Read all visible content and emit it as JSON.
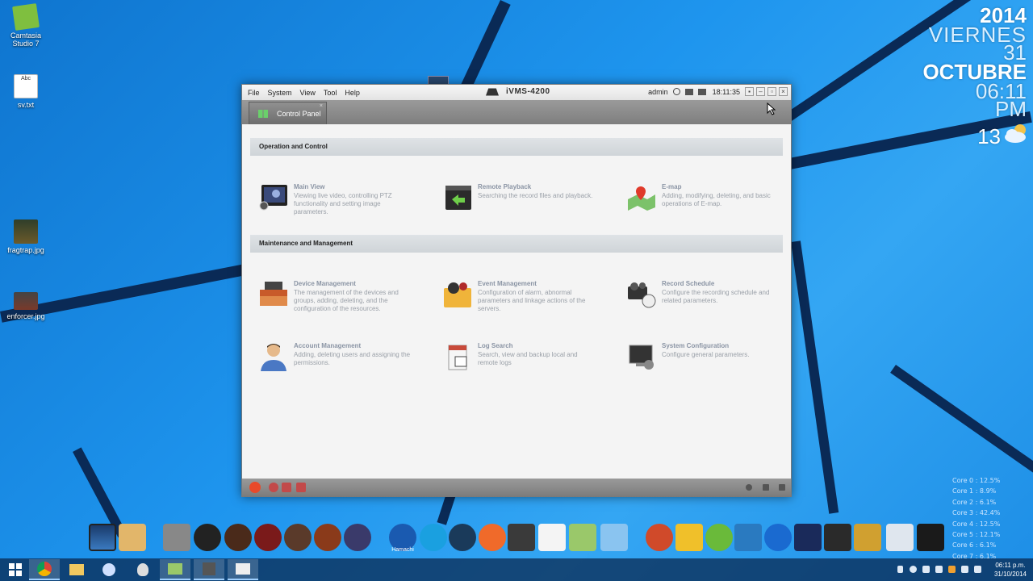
{
  "desktop": {
    "icons": [
      {
        "label": "Camtasia Studio 7",
        "color": "#7fbf3f"
      },
      {
        "label": "sv.txt",
        "color": "#ffffff"
      },
      {
        "label": "fragtrap.jpg",
        "color": "#3a4a3a"
      },
      {
        "label": "enforcer.jpg",
        "color": "#444444"
      }
    ]
  },
  "widget": {
    "year": "2014",
    "day": "VIERNES",
    "date": "31",
    "month": "OCTUBRE",
    "time": "06:11",
    "ampm": "PM",
    "temp": "13",
    "weather_icon": "cloud-sun-icon"
  },
  "cores": [
    "Core 0 : 12.5%",
    "Core 1 : 8.9%",
    "Core 2 : 6.1%",
    "Core 3 : 42.4%",
    "Core 4 : 12.5%",
    "Core 5 : 12.1%",
    "Core 6 : 6.1%",
    "Core 7 : 6.1%"
  ],
  "window": {
    "menu": [
      "File",
      "System",
      "View",
      "Tool",
      "Help"
    ],
    "title": "iVMS-4200",
    "user": "admin",
    "clock": "18:11:35",
    "tab_label": "Control Panel",
    "sections": {
      "operation": "Operation and Control",
      "maintenance": "Maintenance and Management"
    },
    "modules": {
      "main_view": {
        "name": "Main View",
        "desc": "Viewing live video, controlling PTZ functionality and setting image parameters."
      },
      "remote_playback": {
        "name": "Remote Playback",
        "desc": "Searching the record files and playback."
      },
      "emap": {
        "name": "E-map",
        "desc": "Adding, modifying, deleting, and basic operations of E-map."
      },
      "device_management": {
        "name": "Device Management",
        "desc": "The management of the devices and groups, adding, deleting, and the configuration of the resources."
      },
      "event_management": {
        "name": "Event Management",
        "desc": "Configuration of alarm, abnormal parameters and linkage actions of the servers."
      },
      "record_schedule": {
        "name": "Record Schedule",
        "desc": "Configure the recording schedule and related parameters."
      },
      "account_management": {
        "name": "Account Management",
        "desc": "Adding, deleting users and assigning the permissions."
      },
      "log_search": {
        "name": "Log Search",
        "desc": "Search, view and backup local and remote logs"
      },
      "system_configuration": {
        "name": "System Configuration",
        "desc": "Configure general parameters."
      }
    }
  },
  "dock": {
    "hamachi_label": "Hamachi"
  },
  "taskbar": {
    "clock_time": "06:11 p.m.",
    "clock_date": "31/10/2014"
  }
}
